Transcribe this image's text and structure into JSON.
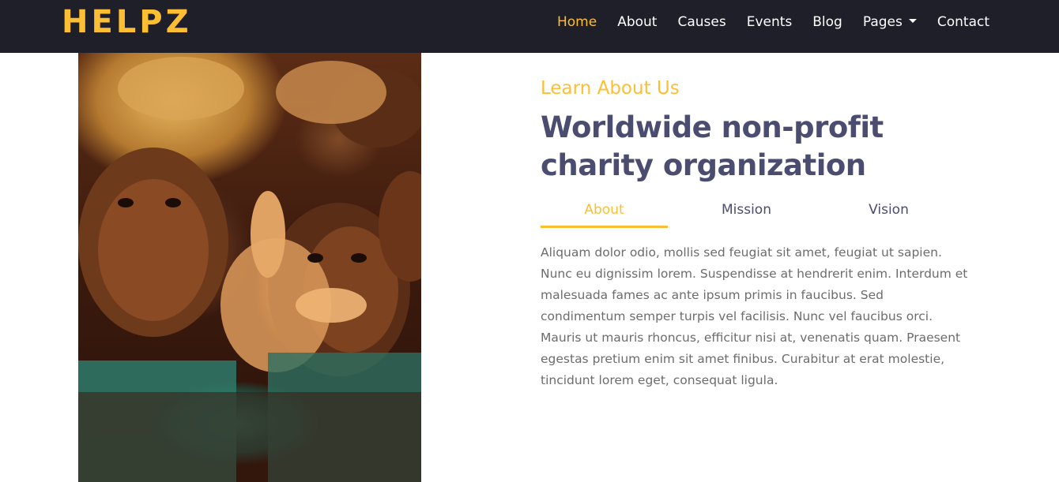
{
  "header": {
    "brand": "HELPZ",
    "nav": [
      {
        "label": "Home",
        "active": true
      },
      {
        "label": "About"
      },
      {
        "label": "Causes"
      },
      {
        "label": "Events"
      },
      {
        "label": "Blog"
      },
      {
        "label": "Pages",
        "dropdown": true
      },
      {
        "label": "Contact"
      }
    ]
  },
  "about": {
    "subtitle": "Learn About Us",
    "title_line1": "Worldwide non-profit",
    "title_line2": "charity organization",
    "tabs": [
      {
        "label": "About",
        "active": true
      },
      {
        "label": "Mission"
      },
      {
        "label": "Vision"
      }
    ],
    "body": "Aliquam dolor odio, mollis sed feugiat sit amet, feugiat ut sapien. Nunc eu dignissim lorem. Suspendisse at hendrerit enim. Interdum et malesuada fames ac ante ipsum primis in faucibus. Sed condimentum semper turpis vel facilisis. Nunc vel faucibus orci. Mauris ut mauris rhoncus, efficitur nisi at, venenatis quam. Praesent egestas pretium enim sit amet finibus. Curabitur at erat molestie, tincidunt lorem eget, consequat ligula."
  },
  "colors": {
    "accent": "#fdbe33",
    "navbar_bg": "#1e1f29",
    "heading": "#4a4c70",
    "body_text": "#6c6c6c"
  },
  "image": {
    "semantic": "photo of children reaching toward the camera"
  }
}
